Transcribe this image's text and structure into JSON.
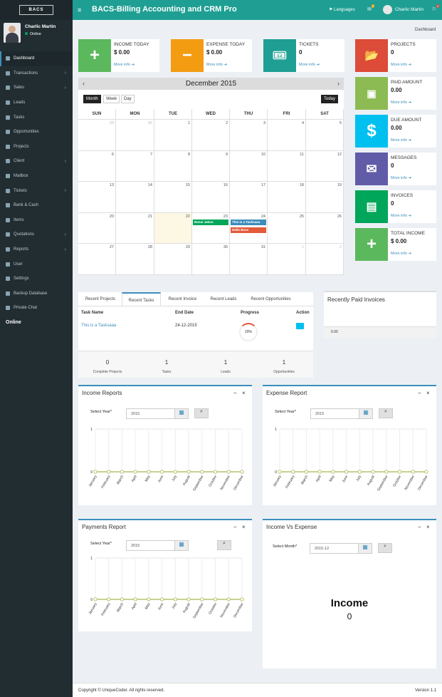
{
  "app": {
    "title": "BACS-Billing Accounting and CRM Pro",
    "logo_text": "BACS"
  },
  "topbar": {
    "languages": "Languages",
    "user": "Charlic Martin",
    "env_badge": "9",
    "flag_badge": "9"
  },
  "user": {
    "name": "Charlic Martin",
    "status": "Online"
  },
  "sidebar": {
    "items": [
      {
        "label": "Dashboard"
      },
      {
        "label": "Transactions"
      },
      {
        "label": "Sales"
      },
      {
        "label": "Leads"
      },
      {
        "label": "Tasks"
      },
      {
        "label": "Opportunities"
      },
      {
        "label": "Projects"
      },
      {
        "label": "Client"
      },
      {
        "label": "Mailbox"
      },
      {
        "label": "Tickets"
      },
      {
        "label": "Bank & Cash"
      },
      {
        "label": "Items"
      },
      {
        "label": "Quotations"
      },
      {
        "label": "Reports"
      },
      {
        "label": "User"
      },
      {
        "label": "Settings"
      },
      {
        "label": "Backup Database"
      },
      {
        "label": "Private Chat"
      }
    ],
    "online": "Online"
  },
  "breadcrumb": "Dashboard",
  "info_boxes": {
    "income": {
      "label": "INCOME TODAY",
      "value": "$ 0.00",
      "more": "More info"
    },
    "expense": {
      "label": "EXPENSE TODAY",
      "value": "$ 0.00",
      "more": "More info"
    },
    "tickets": {
      "label": "TICKETS",
      "value": "0",
      "more": "More info"
    },
    "projects": {
      "label": "PROJECTS",
      "value": "0",
      "more": "More info"
    },
    "paid": {
      "label": "PAID AMOUNT",
      "value": "0.00",
      "more": "More info"
    },
    "due": {
      "label": "DUE AMOUNT",
      "value": "0.00",
      "more": "More info"
    },
    "messages": {
      "label": "MESSAGES",
      "value": "0",
      "more": "More info"
    },
    "invoices": {
      "label": "INVOICES",
      "value": "0",
      "more": "More info"
    },
    "total_income": {
      "label": "TOTAL INCOME",
      "value": "$ 0.00",
      "more": "More info"
    }
  },
  "calendar": {
    "month": "December 2015",
    "views": [
      "Month",
      "Week",
      "Day"
    ],
    "today": "Today",
    "days": [
      "SUN",
      "MON",
      "TUE",
      "WED",
      "THU",
      "FRI",
      "SAT"
    ],
    "weeks": [
      [
        "29",
        "30",
        "1",
        "2",
        "3",
        "4",
        "5"
      ],
      [
        "6",
        "7",
        "8",
        "9",
        "10",
        "11",
        "12"
      ],
      [
        "13",
        "14",
        "15",
        "16",
        "17",
        "18",
        "19"
      ],
      [
        "20",
        "21",
        "22",
        "23",
        "24",
        "25",
        "26"
      ],
      [
        "27",
        "28",
        "29",
        "30",
        "31",
        "1",
        "2"
      ]
    ],
    "events": [
      "Banai Jaboo",
      "This is a Tasksaaa",
      "Hello Boss"
    ]
  },
  "tabs": {
    "items": [
      "Recent Projects",
      "Recent Tasks",
      "Recent Invoice",
      "Recent Leads",
      "Recent Opportunities"
    ],
    "headers": [
      "Task Name",
      "End Date",
      "Progress",
      "Action"
    ],
    "row": {
      "name": "This is a Tasksaaa",
      "end": "24-12-2015",
      "progress": "20%"
    },
    "stats": [
      {
        "n": "0",
        "l": "Complete Projects"
      },
      {
        "n": "1",
        "l": "Tasks"
      },
      {
        "n": "1",
        "l": "Leads"
      },
      {
        "n": "1",
        "l": "Opportunities"
      }
    ]
  },
  "recent_paid": {
    "title": "Recently Paid Invoices",
    "value": "0.00"
  },
  "income_report": {
    "title": "Income Reports",
    "select_label": "Select Year*",
    "year": "2015"
  },
  "expense_report": {
    "title": "Expense Report",
    "select_label": "Select Year*",
    "year": "2015"
  },
  "payments_report": {
    "title": "Payments Report",
    "select_label": "Select Year*",
    "year": "2015"
  },
  "income_vs_expense": {
    "title": "Income Vs Expense",
    "select_label": "Select Month*",
    "month": "2015-12",
    "big_label": "Income",
    "big_value": "0"
  },
  "chart_data": [
    {
      "type": "line",
      "title": "Income Reports",
      "categories": [
        "January",
        "February",
        "March",
        "April",
        "May",
        "June",
        "July",
        "August",
        "September",
        "October",
        "November",
        "December"
      ],
      "values": [
        0,
        0,
        0,
        0,
        0,
        0,
        0,
        0,
        0,
        0,
        0,
        0
      ],
      "ylim": [
        0,
        1
      ]
    },
    {
      "type": "line",
      "title": "Expense Report",
      "categories": [
        "January",
        "February",
        "March",
        "April",
        "May",
        "June",
        "July",
        "August",
        "September",
        "October",
        "November",
        "December"
      ],
      "values": [
        0,
        0,
        0,
        0,
        0,
        0,
        0,
        0,
        0,
        0,
        0,
        0
      ],
      "ylim": [
        0,
        1
      ]
    },
    {
      "type": "line",
      "title": "Payments Report",
      "categories": [
        "January",
        "February",
        "March",
        "April",
        "May",
        "June",
        "July",
        "August",
        "September",
        "October",
        "November",
        "December"
      ],
      "values": [
        0,
        0,
        0,
        0,
        0,
        0,
        0,
        0,
        0,
        0,
        0,
        0
      ],
      "ylim": [
        0,
        1
      ]
    }
  ],
  "footer": {
    "copyright": "Copyright © UniqueCoder. All rights reserved.",
    "version": "Version 1.1"
  }
}
